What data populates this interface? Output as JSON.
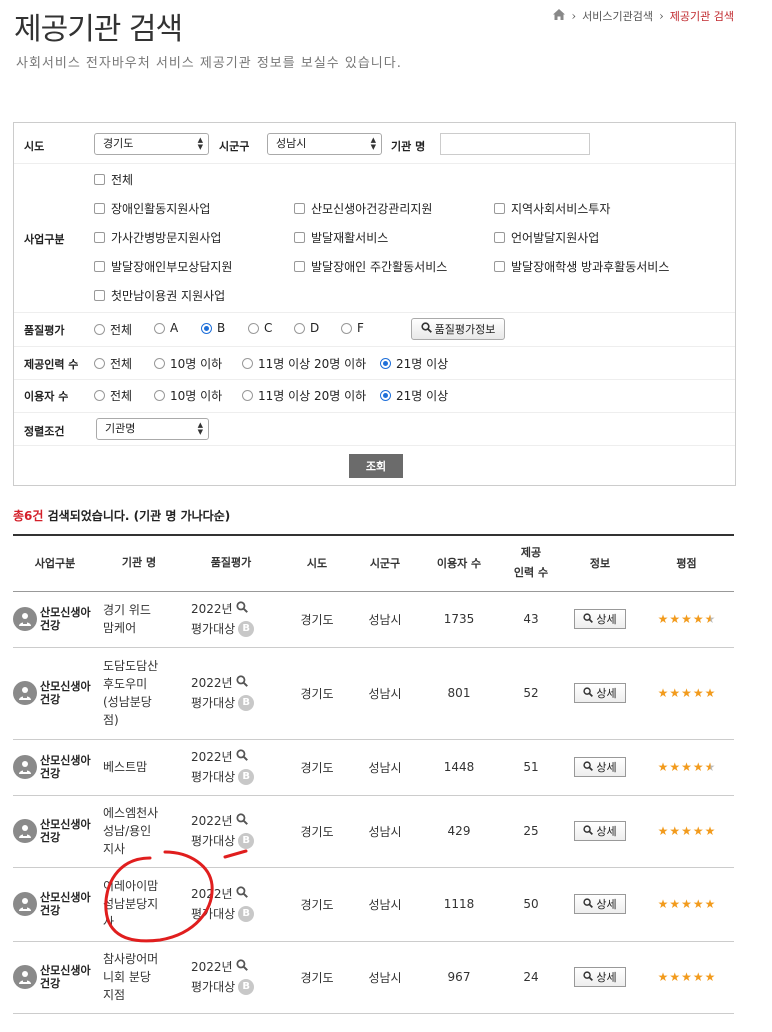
{
  "header": {
    "title": "제공기관 검색",
    "subtitle": "사회서비스 전자바우처 서비스 제공기관 정보를 보실수 있습니다.",
    "breadcrumb": [
      "서비스기관검색",
      "제공기관 검색"
    ]
  },
  "filters": {
    "sido_label": "시도",
    "sido_value": "경기도",
    "sigungu_label": "시군구",
    "sigungu_value": "성남시",
    "agency_label": "기관 명",
    "agency_value": "",
    "biz_label": "사업구분",
    "biz_options": [
      "전체",
      "장애인활동지원사업",
      "산모신생아건강관리지원",
      "지역사회서비스투자",
      "가사간병방문지원사업",
      "발달재활서비스",
      "언어발달지원사업",
      "발달장애인부모상담지원",
      "발달장애인 주간활동서비스",
      "발달장애학생 방과후활동서비스",
      "첫만남이용권 지원사업"
    ],
    "quality_label": "품질평가",
    "quality_options": [
      "전체",
      "A",
      "B",
      "C",
      "D",
      "F"
    ],
    "quality_selected": "B",
    "quality_button": "품질평가정보",
    "staff_label": "제공인력 수",
    "staff_options": [
      "전체",
      "10명 이하",
      "11명 이상 20명 이하",
      "21명 이상"
    ],
    "staff_selected": "21명 이상",
    "users_label": "이용자 수",
    "users_options": [
      "전체",
      "10명 이하",
      "11명 이상 20명 이하",
      "21명 이상"
    ],
    "users_selected": "21명 이상",
    "sort_label": "정렬조건",
    "sort_value": "기관명",
    "search_button": "조회"
  },
  "summary": {
    "count_text": "총6건",
    "rest_text": " 검색되었습니다. (기관 명 가나다순)"
  },
  "table": {
    "headers": [
      "사업구분",
      "기관 명",
      "품질평가",
      "시도",
      "시군구",
      "이용자 수",
      "제공\n인력 수",
      "정보",
      "평점"
    ],
    "detail_label": "상세",
    "rows": [
      {
        "biz": "산모신생아\n건강",
        "name": "경기 위드\n맘케어",
        "q_year": "2022년",
        "q_status": "평가대상",
        "grade": "B",
        "sido": "경기도",
        "sigungu": "성남시",
        "users": "1735",
        "staff": "43",
        "rating": 4.5
      },
      {
        "biz": "산모신생아\n건강",
        "name": "도담도담산\n후도우미\n(성남분당\n점)",
        "q_year": "2022년",
        "q_status": "평가대상",
        "grade": "B",
        "sido": "경기도",
        "sigungu": "성남시",
        "users": "801",
        "staff": "52",
        "rating": 5
      },
      {
        "biz": "산모신생아\n건강",
        "name": "베스트맘",
        "q_year": "2022년",
        "q_status": "평가대상",
        "grade": "B",
        "sido": "경기도",
        "sigungu": "성남시",
        "users": "1448",
        "staff": "51",
        "rating": 4.5
      },
      {
        "biz": "산모신생아\n건강",
        "name": "에스엠천사\n성남/용인\n지사",
        "q_year": "2022년",
        "q_status": "평가대상",
        "grade": "B",
        "sido": "경기도",
        "sigungu": "성남시",
        "users": "429",
        "staff": "25",
        "rating": 5
      },
      {
        "biz": "산모신생아\n건강",
        "name": "이레아이맘\n성남분당지\n사",
        "q_year": "2022년",
        "q_status": "평가대상",
        "grade": "B",
        "sido": "경기도",
        "sigungu": "성남시",
        "users": "1118",
        "staff": "50",
        "rating": 5
      },
      {
        "biz": "산모신생아\n건강",
        "name": "참사랑어머\n니회 분당\n지점",
        "q_year": "2022년",
        "q_status": "평가대상",
        "grade": "B",
        "sido": "경기도",
        "sigungu": "성남시",
        "users": "967",
        "staff": "24",
        "rating": 5
      }
    ]
  },
  "colors": {
    "accent": "#c0282d",
    "count": "#d4202a",
    "star": "#f29b1d",
    "radio_on": "#1e6fd9",
    "annotation": "#e01e1e"
  }
}
